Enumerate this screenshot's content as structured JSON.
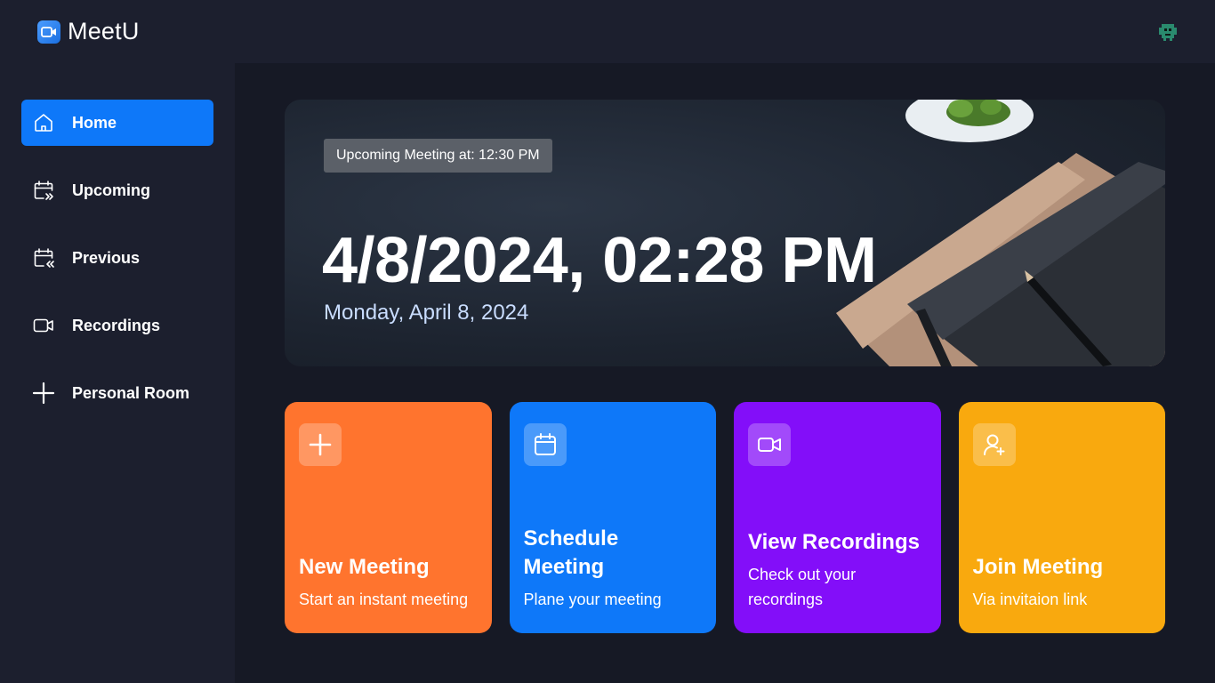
{
  "app": {
    "name": "MeetU",
    "accent": "#0e78f9"
  },
  "header": {
    "logo_icon": "video-camera-icon",
    "avatar_icon": "user-avatar-icon"
  },
  "sidebar": {
    "items": [
      {
        "label": "Home",
        "icon": "home-icon",
        "active": true
      },
      {
        "label": "Upcoming",
        "icon": "calendar-upcoming-icon",
        "active": false
      },
      {
        "label": "Previous",
        "icon": "calendar-previous-icon",
        "active": false
      },
      {
        "label": "Recordings",
        "icon": "video-icon",
        "active": false
      },
      {
        "label": "Personal Room",
        "icon": "plus-icon",
        "active": false
      }
    ]
  },
  "hero": {
    "badge": "Upcoming Meeting at: 12:30 PM",
    "time": "4/8/2024, 02:28 PM",
    "date": "Monday, April 8, 2024"
  },
  "cards": [
    {
      "title": "New Meeting",
      "subtitle": "Start an instant meeting",
      "icon": "plus-icon",
      "color": "#ff742e"
    },
    {
      "title": "Schedule Meeting",
      "subtitle": "Plane your meeting",
      "icon": "calendar-icon",
      "color": "#0e78f9"
    },
    {
      "title": "View Recordings",
      "subtitle": "Check out your recordings",
      "icon": "video-icon",
      "color": "#830ef9"
    },
    {
      "title": "Join Meeting",
      "subtitle": "Via invitaion link",
      "icon": "add-user-icon",
      "color": "#f9a90e"
    }
  ]
}
